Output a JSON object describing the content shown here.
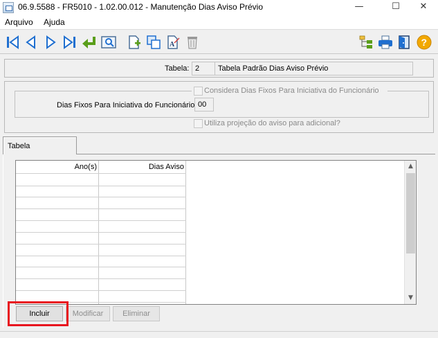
{
  "window": {
    "title": "06.9.5588 - FR5010 - 1.02.00.012 - Manutenção Dias Aviso Prévio",
    "minimize": "—",
    "maximize": "☐",
    "close": "✕"
  },
  "menu": {
    "items": [
      {
        "label": "Arquivo"
      },
      {
        "label": "Ajuda"
      }
    ]
  },
  "toolbar": {
    "icons": [
      "first-icon",
      "previous-icon",
      "next-icon",
      "last-icon",
      "goto-icon",
      "search-icon",
      "new-record-icon",
      "copy-icon",
      "edit-icon",
      "delete-icon",
      "tree-icon",
      "print-icon",
      "exit-icon",
      "help-icon"
    ],
    "colors": {
      "nav": "#1f6fd0",
      "green": "#5a9e1a",
      "help": "#f2a800"
    }
  },
  "header": {
    "tabela_label": "Tabela:",
    "tabela_code": "2",
    "tabela_desc": "Tabela Padrão Dias Aviso Prévio"
  },
  "options": {
    "considera_label": "Considera Dias Fixos Para Iniciativa do Funcionário",
    "considera_checked": false,
    "dias_fixos_label": "Dias Fixos Para Iniciativa do Funcionário:",
    "dias_fixos_value": "00",
    "projecao_label": "Utiliza projeção do aviso para adicional?",
    "projecao_checked": false
  },
  "tabs": [
    {
      "label": "Tabela"
    }
  ],
  "grid": {
    "columns": [
      "Ano(s)",
      "Dias Aviso"
    ],
    "rows": []
  },
  "buttons": {
    "incluir": "Incluir",
    "modificar": "Modificar",
    "eliminar": "Eliminar"
  }
}
